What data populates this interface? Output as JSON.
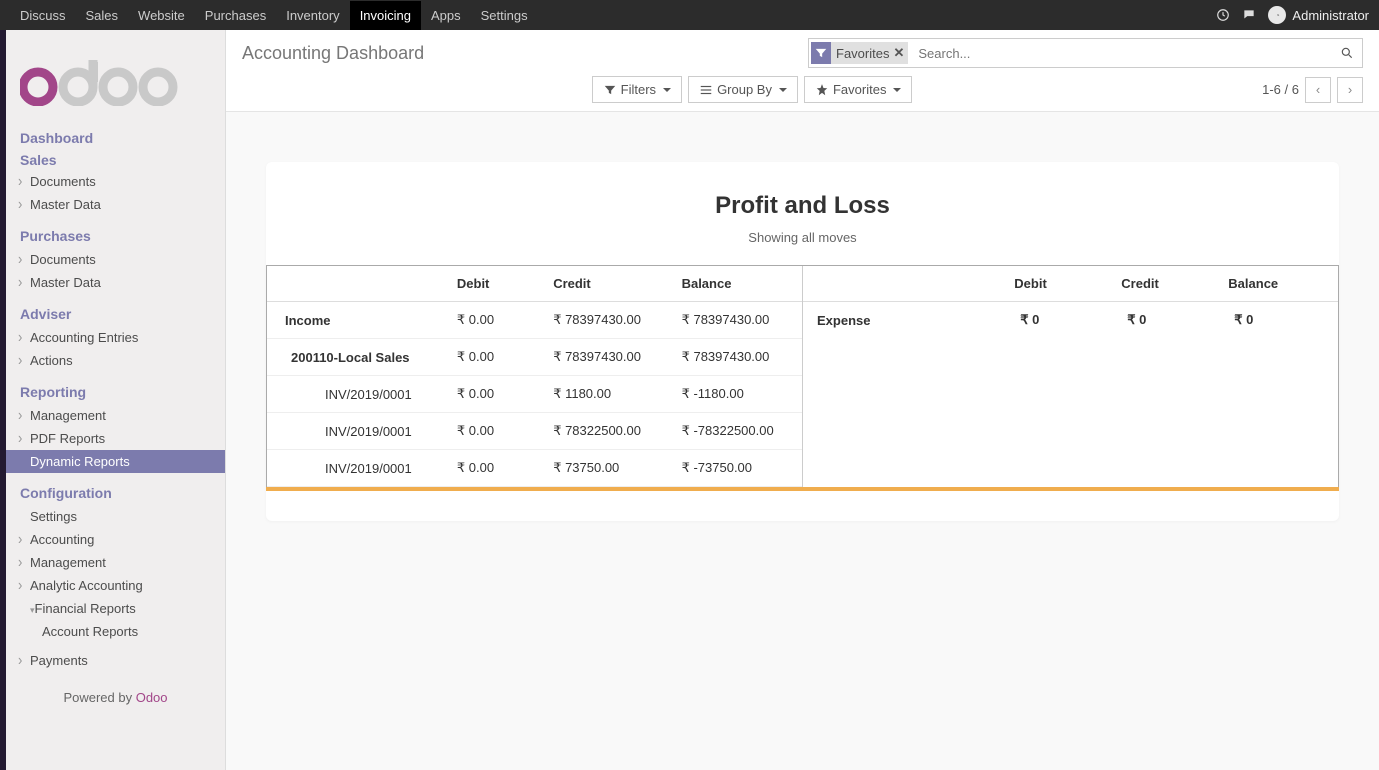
{
  "topnav": {
    "items": [
      "Discuss",
      "Sales",
      "Website",
      "Purchases",
      "Inventory",
      "Invoicing",
      "Apps",
      "Settings"
    ],
    "active_index": 5,
    "user": "Administrator"
  },
  "sidebar": {
    "dashboard_head": "Dashboard",
    "sales_head": "Sales",
    "sales_items": [
      "Documents",
      "Master Data"
    ],
    "purchases_head": "Purchases",
    "purchases_items": [
      "Documents",
      "Master Data"
    ],
    "adviser_head": "Adviser",
    "adviser_items": [
      "Accounting Entries",
      "Actions"
    ],
    "reporting_head": "Reporting",
    "reporting_items": [
      "Management",
      "PDF Reports",
      "Dynamic Reports"
    ],
    "reporting_active_index": 2,
    "config_head": "Configuration",
    "config_settings": "Settings",
    "config_items": [
      "Accounting",
      "Management",
      "Analytic Accounting",
      "Financial Reports"
    ],
    "config_sub": "Account Reports",
    "config_payments": "Payments",
    "footer_prefix": "Powered by ",
    "footer_brand": "Odoo"
  },
  "cp": {
    "title": "Accounting Dashboard",
    "search_tag": "Favorites",
    "search_placeholder": "Search...",
    "filters_label": "Filters",
    "groupby_label": "Group By",
    "favorites_label": "Favorites",
    "pager": "1-6 / 6"
  },
  "report": {
    "title": "Profit and Loss",
    "subtitle": "Showing all moves",
    "left": {
      "headers": [
        "",
        "Debit",
        "Credit",
        "Balance"
      ],
      "rows": [
        {
          "cls": "row-main",
          "cells": [
            "Income",
            "₹ 0.00",
            "₹ 78397430.00",
            "₹ 78397430.00"
          ]
        },
        {
          "cls": "row-sub",
          "cells": [
            "200110-Local Sales",
            "₹ 0.00",
            "₹ 78397430.00",
            "₹ 78397430.00"
          ]
        },
        {
          "cls": "row-inv",
          "cells": [
            "INV/2019/0001",
            "₹ 0.00",
            "₹ 1180.00",
            "₹ -1180.00"
          ]
        },
        {
          "cls": "row-inv",
          "cells": [
            "INV/2019/0001",
            "₹ 0.00",
            "₹ 78322500.00",
            "₹ -78322500.00"
          ]
        },
        {
          "cls": "row-inv",
          "cells": [
            "INV/2019/0001",
            "₹ 0.00",
            "₹ 73750.00",
            "₹ -73750.00"
          ]
        }
      ]
    },
    "right": {
      "headers": [
        "",
        "Debit",
        "Credit",
        "Balance"
      ],
      "row": [
        "Expense",
        "₹ 0",
        "₹ 0",
        "₹ 0"
      ]
    }
  }
}
